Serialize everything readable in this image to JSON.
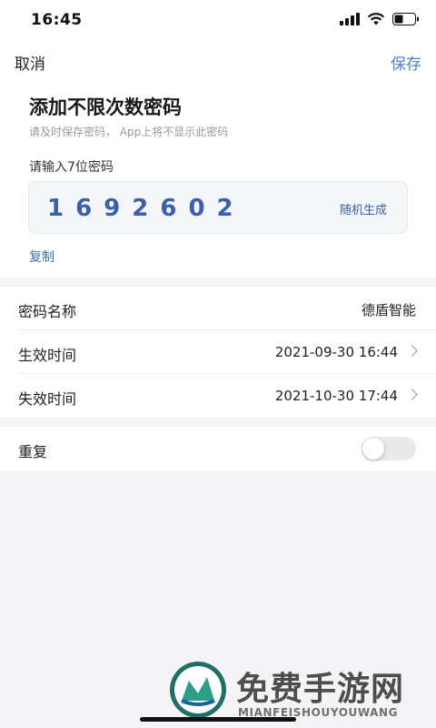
{
  "status_bar": {
    "time": "16:45"
  },
  "nav": {
    "cancel_label": "取消",
    "save_label": "保存"
  },
  "header": {
    "title": "添加不限次数密码",
    "subtitle": "请及时保存密码， App上将不显示此密码"
  },
  "password": {
    "prompt": "请输入7位密码",
    "value": "1692602",
    "random_label": "随机生成",
    "copy_label": "复制"
  },
  "fields": {
    "name": {
      "label": "密码名称",
      "value": "德盾智能"
    },
    "start": {
      "label": "生效时间",
      "value": "2021-09-30 16:44"
    },
    "end": {
      "label": "失效时间",
      "value": "2021-10-30 17:44"
    }
  },
  "repeat": {
    "label": "重复",
    "enabled": false
  },
  "watermark": {
    "text": "免费手游网",
    "sub": "MIANFEISHOUYOUWANG"
  },
  "colors": {
    "accent": "#3a5fae",
    "link": "#4a86c8",
    "background": "#f4f4f6"
  }
}
